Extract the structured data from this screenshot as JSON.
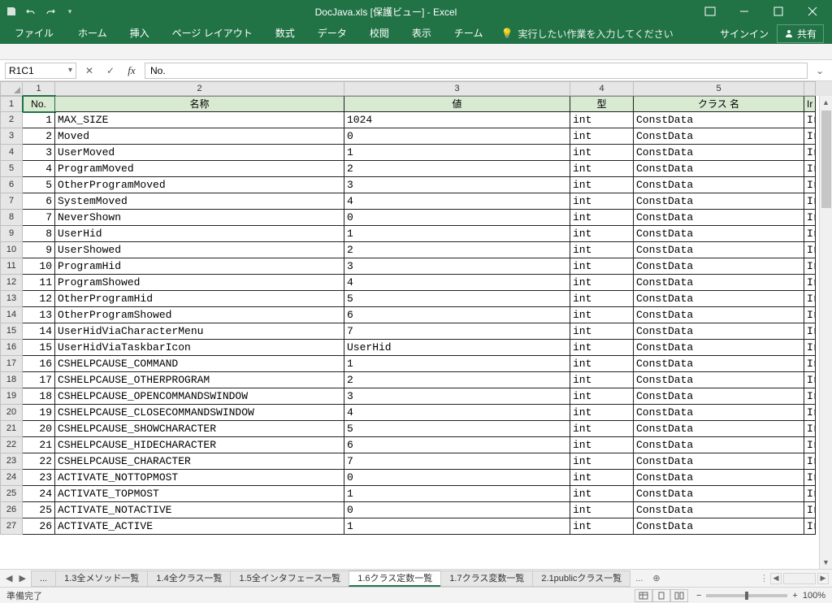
{
  "title": "DocJava.xls [保護ビュー] - Excel",
  "qat": {
    "save": "save",
    "undo": "undo",
    "redo": "redo"
  },
  "ribbon": {
    "tabs": [
      "ファイル",
      "ホーム",
      "挿入",
      "ページ レイアウト",
      "数式",
      "データ",
      "校閲",
      "表示",
      "チーム"
    ],
    "tellme": "実行したい作業を入力してください",
    "signin": "サインイン",
    "share": "共有"
  },
  "formula_bar": {
    "namebox": "R1C1",
    "value": "No."
  },
  "col_nums": [
    "1",
    "2",
    "3",
    "4",
    "5"
  ],
  "headers": {
    "c1": "No.",
    "c2": "名称",
    "c3": "値",
    "c4": "型",
    "c5": "クラス 名",
    "c6": "Ir"
  },
  "rows": [
    {
      "n": "1",
      "name": "MAX_SIZE",
      "val": "1024",
      "type": "int",
      "cls": "ConstData",
      "e": "Ir"
    },
    {
      "n": "2",
      "name": "Moved",
      "val": "0",
      "type": "int",
      "cls": "ConstData",
      "e": "Ir"
    },
    {
      "n": "3",
      "name": "UserMoved",
      "val": "1",
      "type": "int",
      "cls": "ConstData",
      "e": "Ir"
    },
    {
      "n": "4",
      "name": "ProgramMoved",
      "val": "2",
      "type": "int",
      "cls": "ConstData",
      "e": "Ir"
    },
    {
      "n": "5",
      "name": "OtherProgramMoved",
      "val": "3",
      "type": "int",
      "cls": "ConstData",
      "e": "Ir"
    },
    {
      "n": "6",
      "name": "SystemMoved",
      "val": "4",
      "type": "int",
      "cls": "ConstData",
      "e": "Ir"
    },
    {
      "n": "7",
      "name": "NeverShown",
      "val": "0",
      "type": "int",
      "cls": "ConstData",
      "e": "Ir"
    },
    {
      "n": "8",
      "name": "UserHid",
      "val": "1",
      "type": "int",
      "cls": "ConstData",
      "e": "Ir"
    },
    {
      "n": "9",
      "name": "UserShowed",
      "val": "2",
      "type": "int",
      "cls": "ConstData",
      "e": "Ir"
    },
    {
      "n": "10",
      "name": "ProgramHid",
      "val": "3",
      "type": "int",
      "cls": "ConstData",
      "e": "Ir"
    },
    {
      "n": "11",
      "name": "ProgramShowed",
      "val": "4",
      "type": "int",
      "cls": "ConstData",
      "e": "Ir"
    },
    {
      "n": "12",
      "name": "OtherProgramHid",
      "val": "5",
      "type": "int",
      "cls": "ConstData",
      "e": "Ir"
    },
    {
      "n": "13",
      "name": "OtherProgramShowed",
      "val": "6",
      "type": "int",
      "cls": "ConstData",
      "e": "Ir"
    },
    {
      "n": "14",
      "name": "UserHidViaCharacterMenu",
      "val": "7",
      "type": "int",
      "cls": "ConstData",
      "e": "Ir"
    },
    {
      "n": "15",
      "name": "UserHidViaTaskbarIcon",
      "val": "UserHid",
      "type": "int",
      "cls": "ConstData",
      "e": "Ir"
    },
    {
      "n": "16",
      "name": "CSHELPCAUSE_COMMAND",
      "val": "1",
      "type": "int",
      "cls": "ConstData",
      "e": "Ir"
    },
    {
      "n": "17",
      "name": "CSHELPCAUSE_OTHERPROGRAM",
      "val": "2",
      "type": "int",
      "cls": "ConstData",
      "e": "Ir"
    },
    {
      "n": "18",
      "name": "CSHELPCAUSE_OPENCOMMANDSWINDOW",
      "val": "3",
      "type": "int",
      "cls": "ConstData",
      "e": "Ir"
    },
    {
      "n": "19",
      "name": "CSHELPCAUSE_CLOSECOMMANDSWINDOW",
      "val": "4",
      "type": "int",
      "cls": "ConstData",
      "e": "Ir"
    },
    {
      "n": "20",
      "name": "CSHELPCAUSE_SHOWCHARACTER",
      "val": "5",
      "type": "int",
      "cls": "ConstData",
      "e": "Ir"
    },
    {
      "n": "21",
      "name": "CSHELPCAUSE_HIDECHARACTER",
      "val": "6",
      "type": "int",
      "cls": "ConstData",
      "e": "Ir"
    },
    {
      "n": "22",
      "name": "CSHELPCAUSE_CHARACTER",
      "val": "7",
      "type": "int",
      "cls": "ConstData",
      "e": "Ir"
    },
    {
      "n": "23",
      "name": "ACTIVATE_NOTTOPMOST",
      "val": "0",
      "type": "int",
      "cls": "ConstData",
      "e": "Ir"
    },
    {
      "n": "24",
      "name": "ACTIVATE_TOPMOST",
      "val": "1",
      "type": "int",
      "cls": "ConstData",
      "e": "Ir"
    },
    {
      "n": "25",
      "name": "ACTIVATE_NOTACTIVE",
      "val": "0",
      "type": "int",
      "cls": "ConstData",
      "e": "Ir"
    },
    {
      "n": "26",
      "name": "ACTIVATE_ACTIVE",
      "val": "1",
      "type": "int",
      "cls": "ConstData",
      "e": "Ir"
    }
  ],
  "sheets": {
    "prev": "...",
    "tabs": [
      "1.3全メソッド一覧",
      "1.4全クラス一覧",
      "1.5全インタフェース一覧",
      "1.6クラス定数一覧",
      "1.7クラス変数一覧",
      "2.1publicクラス一覧"
    ],
    "active_index": 3,
    "more": "..."
  },
  "status": {
    "ready": "準備完了",
    "zoom": "100%"
  }
}
